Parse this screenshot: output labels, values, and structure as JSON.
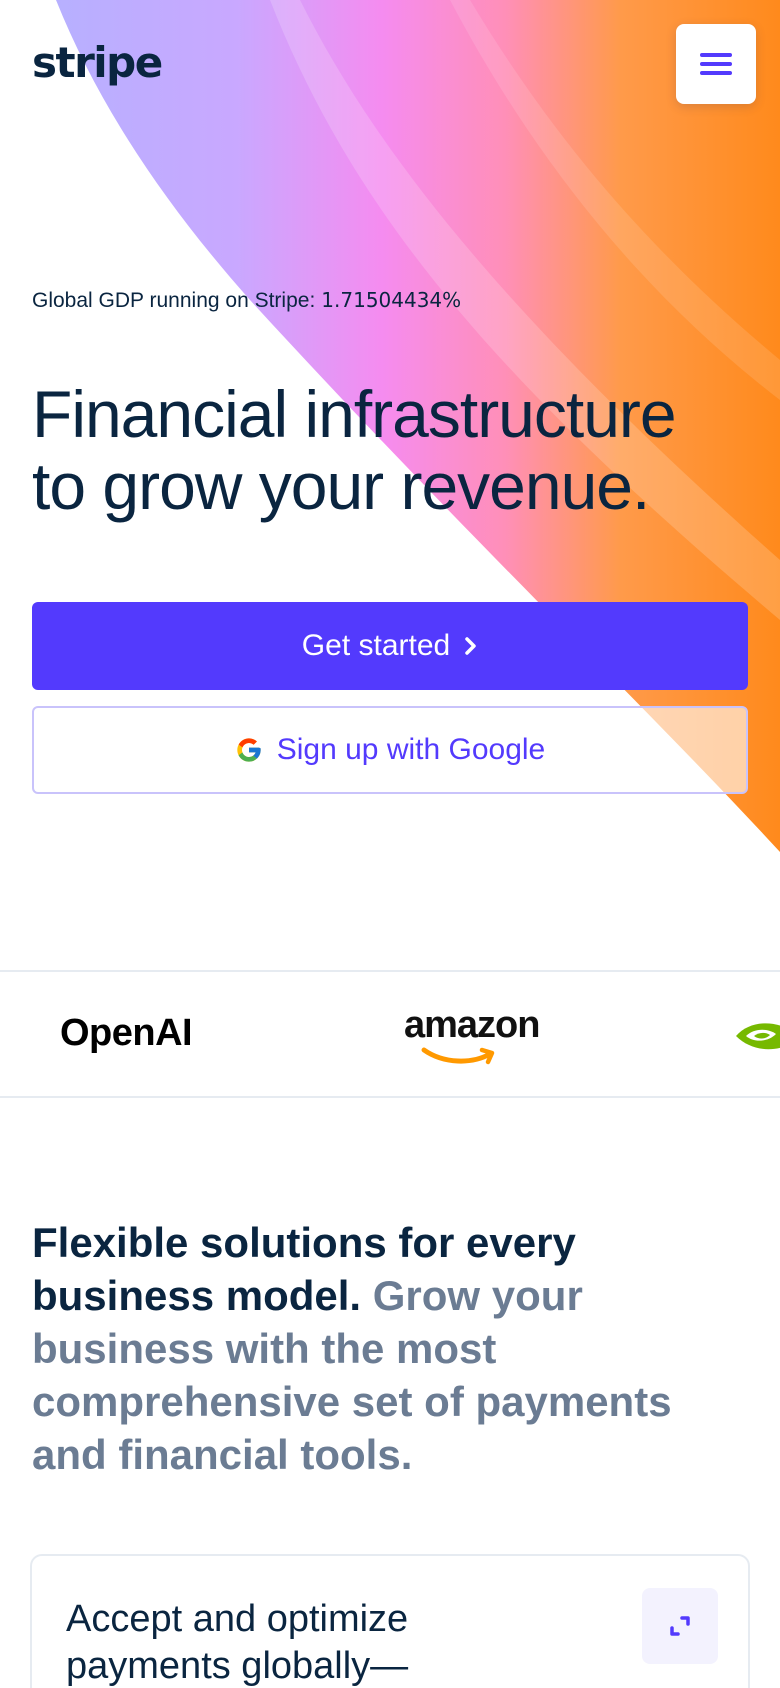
{
  "brand": {
    "logo": "stripe",
    "accent": "#533afd",
    "text": "#0a2540"
  },
  "header": {
    "menu_icon": "hamburger-icon"
  },
  "gdp": {
    "label": "Global GDP running on Stripe:",
    "value": "1.71504434%"
  },
  "hero": {
    "line1": "Financial infrastructure",
    "line2": "to grow your revenue."
  },
  "cta": {
    "primary_label": "Get started",
    "primary_icon": "chevron-right-icon",
    "google_label": "Sign up with Google",
    "google_icon": "google-icon"
  },
  "customers": {
    "openai": "OpenAI",
    "amazon": "amazon",
    "nvidia_icon": "nvidia-eye-icon"
  },
  "section": {
    "title_strong": "Flexible solutions for every business model.",
    "title_muted": "Grow your business with the most comprehensive set of payments and financial tools."
  },
  "card": {
    "title": "Accept and optimize payments globally—",
    "expand_icon": "expand-icon"
  }
}
